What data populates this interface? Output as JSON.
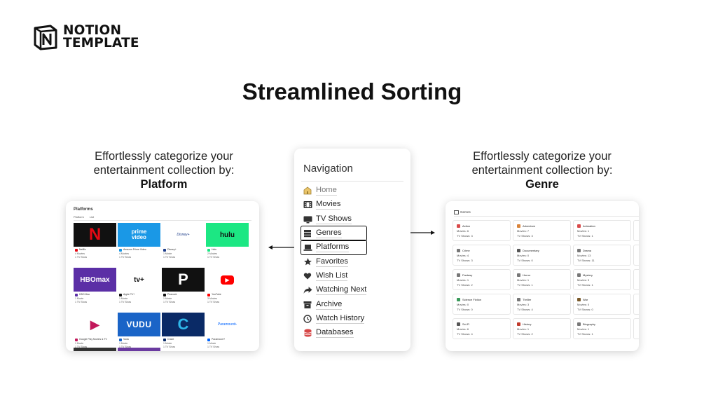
{
  "logo": {
    "line1": "NOTION",
    "line2": "TEMPLATE"
  },
  "title": "Streamlined Sorting",
  "captions": {
    "left": {
      "text": "Effortlessly categorize your entertainment collection by:",
      "emphasis": "Platform"
    },
    "right": {
      "text": "Effortlessly categorize your entertainment collection by:",
      "emphasis": "Genre"
    }
  },
  "platforms": {
    "heading": "Platforms",
    "tabs": [
      "Platform",
      "List"
    ],
    "items": [
      {
        "name": "Netflix",
        "l2": "4 Movies",
        "l3": "1 TV Show",
        "bg": "#111111",
        "logo": "N",
        "logo_color": "#e50914",
        "icon_color": "#e50914"
      },
      {
        "name": "Amazon Prime Video",
        "l2": "4 Movies",
        "l3": "1 TV Show",
        "bg": "#1a98e6",
        "logo": "prime video",
        "logo_color": "#ffffff",
        "icon_color": "#1a98e6"
      },
      {
        "name": "Disney+",
        "l2": "1 Movie",
        "l3": "1 TV Show",
        "bg": "#ffffff",
        "logo": "Disney+",
        "logo_color": "#1f3e8a",
        "icon_color": "#1f3e8a"
      },
      {
        "name": "Hulu",
        "l2": "2 Movies",
        "l3": "1 TV Show",
        "bg": "#1ce783",
        "logo": "hulu",
        "logo_color": "#111111",
        "icon_color": "#1ce783"
      },
      {
        "name": "HBO Max",
        "l2": "1 Movie",
        "l3": "1 TV Show",
        "bg": "#5b2fa6",
        "logo": "HBOmax",
        "logo_color": "#ffffff",
        "icon_color": "#5b2fa6"
      },
      {
        "name": "Apple TV+",
        "l2": "1 Movie",
        "l3": "1 TV Show",
        "bg": "#ffffff",
        "logo": "tv+",
        "logo_color": "#111111",
        "icon_color": "#111111"
      },
      {
        "name": "Peacock",
        "l2": "1 Movie",
        "l3": "1 TV Show",
        "bg": "#111111",
        "logo": "P",
        "logo_color": "#ffffff",
        "icon_color": "#111111"
      },
      {
        "name": "YouTube",
        "l2": "3 Movies",
        "l3": "1 TV Show",
        "bg": "#ffffff",
        "logo": "▶",
        "logo_color": "#ffffff",
        "icon_color": "#ff0000"
      },
      {
        "name": "Google Play Movies & TV",
        "l2": "1 Movie",
        "l3": "1 TV Show",
        "bg": "#ffffff",
        "logo": "▶",
        "logo_color": "#c2185b",
        "icon_color": "#c2185b"
      },
      {
        "name": "Vudu",
        "l2": "1 Movie",
        "l3": "1 TV Show",
        "bg": "#1a64c7",
        "logo": "VUDU",
        "logo_color": "#ffffff",
        "icon_color": "#1a64c7"
      },
      {
        "name": "Crave",
        "l2": "1 Movie",
        "l3": "1 TV Show",
        "bg": "#0a2a66",
        "logo": "C",
        "logo_color": "#2fb7ea",
        "icon_color": "#0a2a66"
      },
      {
        "name": "Paramount+",
        "l2": "1 Movie",
        "l3": "1 TV Show",
        "bg": "#ffffff",
        "logo": "Paramount+",
        "logo_color": "#0064ff",
        "icon_color": "#0064ff"
      }
    ]
  },
  "navigation": {
    "title": "Navigation",
    "items": [
      {
        "label": "Home",
        "icon": "home-icon"
      },
      {
        "label": "Movies",
        "icon": "film-icon"
      },
      {
        "label": "TV Shows",
        "icon": "tv-icon"
      },
      {
        "label": "Genres",
        "icon": "stack-icon"
      },
      {
        "label": "Platforms",
        "icon": "laptop-icon"
      },
      {
        "label": "Favorites",
        "icon": "star-icon"
      },
      {
        "label": "Wish List",
        "icon": "heart-icon"
      },
      {
        "label": "Watching Next",
        "icon": "arrow-icon"
      },
      {
        "label": "Archive",
        "icon": "archive-icon"
      },
      {
        "label": "Watch History",
        "icon": "clock-icon"
      },
      {
        "label": "Databases",
        "icon": "database-icon"
      }
    ]
  },
  "genres": {
    "tab": "Genres",
    "items": [
      {
        "name": "Action",
        "movies": "Movies: 6",
        "shows": "TV Shows: 3",
        "color": "#d94a4a"
      },
      {
        "name": "Adventure",
        "movies": "Movies: 7",
        "shows": "TV Shows: 3",
        "color": "#d9843a"
      },
      {
        "name": "Animation",
        "movies": "Movies: 1",
        "shows": "TV Shows: 1",
        "color": "#d94a4a"
      },
      {
        "name": "Crime",
        "movies": "Movies: 4",
        "shows": "TV Shows: 3",
        "color": "#777777"
      },
      {
        "name": "Documentary",
        "movies": "Movies: 0",
        "shows": "TV Shows: 0",
        "color": "#555555"
      },
      {
        "name": "Drama",
        "movies": "Movies: 13",
        "shows": "TV Shows: 11",
        "color": "#777777"
      },
      {
        "name": "Fantasy",
        "movies": "Movies: 1",
        "shows": "TV Shows: 2",
        "color": "#777777"
      },
      {
        "name": "Horror",
        "movies": "Movies: 1",
        "shows": "TV Shows: 1",
        "color": "#777777"
      },
      {
        "name": "Mystery",
        "movies": "Movies: 3",
        "shows": "TV Shows: 1",
        "color": "#777777"
      },
      {
        "name": "Science Fiction",
        "movies": "Movies: 0",
        "shows": "TV Shows: 0",
        "color": "#3a9a5a"
      },
      {
        "name": "Thriller",
        "movies": "Movies: 3",
        "shows": "TV Shows: 4",
        "color": "#777777"
      },
      {
        "name": "War",
        "movies": "Movies: 0",
        "shows": "TV Shows: 0",
        "color": "#7a5a2a"
      },
      {
        "name": "Sci-Fi",
        "movies": "Movies: 6",
        "shows": "TV Shows: 4",
        "color": "#555555"
      },
      {
        "name": "History",
        "movies": "Movies: 1",
        "shows": "TV Shows: 2",
        "color": "#c0392b"
      },
      {
        "name": "Biography",
        "movies": "Movies: 1",
        "shows": "TV Shows: 1",
        "color": "#777777"
      }
    ]
  }
}
